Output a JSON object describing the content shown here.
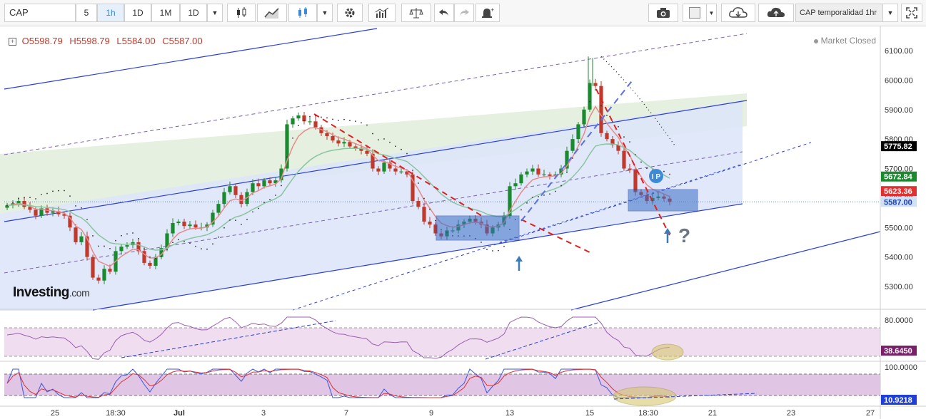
{
  "toolbar": {
    "symbol": "CAP",
    "intervals": [
      "5",
      "1h",
      "1D",
      "1M",
      "1D"
    ],
    "active_interval": "1h",
    "layout_name": "CAP temporalidad 1hr",
    "icons": [
      "dropdown-caret-icon",
      "candlestick-icon",
      "line-chart-icon",
      "candle-style-icon",
      "dropdown-caret-icon",
      "gear-icon",
      "indicators-icon",
      "compare-icon",
      "undo-icon",
      "redo-icon",
      "alert-icon",
      "camera-icon",
      "color-box-icon",
      "dropdown-caret-icon",
      "cloud-download-icon",
      "cloud-upload-icon",
      "dropdown-caret-icon",
      "fullscreen-icon"
    ]
  },
  "legend": {
    "open": "O5598.79",
    "high": "H5598.79",
    "low": "L5584.00",
    "close": "C5587.00"
  },
  "status": {
    "market": "Market Closed"
  },
  "logo": {
    "name": "Investing",
    "suffix": ".com"
  },
  "annotations": {
    "ip_label": "I P",
    "question_mark": "?"
  },
  "chart_data": [
    {
      "type": "candlestick",
      "title": "CAP",
      "ylabel": "",
      "ylim": [
        5220,
        6140
      ],
      "yticks": [
        5300,
        5400,
        5500,
        5600,
        5700,
        5800,
        5900,
        6000,
        6100
      ],
      "ytick_labels": [
        "5300.00",
        "5400.00",
        "5500.00",
        "5600.00",
        "5700.00",
        "5800.00",
        "5900.00",
        "6000.00",
        "6100.00"
      ],
      "xtick_labels": [
        "25",
        "18:30",
        "Jul",
        "3",
        "7",
        "9",
        "13",
        "15",
        "18:30",
        "21",
        "23",
        "27"
      ],
      "price_labels": [
        {
          "value": 5775.82,
          "label": "5775.82",
          "color": "#000000"
        },
        {
          "value": 5672.84,
          "label": "5672.84",
          "color": "#1a8a2e"
        },
        {
          "value": 5623.36,
          "label": "5623.36",
          "color": "#e03030"
        },
        {
          "value": 5587.0,
          "label": "5587.00",
          "color": "#cfe0f7"
        }
      ],
      "series": [
        {
          "name": "price",
          "type": "candle",
          "values": [
            5575,
            5582,
            5590,
            5570,
            5560,
            5540,
            5565,
            5550,
            5555,
            5545,
            5540,
            5500,
            5450,
            5470,
            5400,
            5330,
            5320,
            5360,
            5350,
            5420,
            5435,
            5440,
            5450,
            5420,
            5380,
            5370,
            5400,
            5430,
            5480,
            5515,
            5520,
            5505,
            5510,
            5500,
            5500,
            5510,
            5550,
            5580,
            5620,
            5640,
            5610,
            5580,
            5620,
            5650,
            5640,
            5660,
            5650,
            5660,
            5700,
            5850,
            5870,
            5880,
            5860,
            5860,
            5840,
            5820,
            5810,
            5795,
            5785,
            5790,
            5775,
            5770,
            5760,
            5750,
            5700,
            5690,
            5720,
            5700,
            5690,
            5690,
            5680,
            5590,
            5570,
            5520,
            5510,
            5480,
            5470,
            5490,
            5490,
            5510,
            5520,
            5530,
            5520,
            5510,
            5480,
            5500,
            5510,
            5540,
            5640,
            5650,
            5680,
            5690,
            5700,
            5680,
            5680,
            5675,
            5680,
            5700,
            5760,
            5800,
            5850,
            5900,
            5990,
            5980,
            5820,
            5800,
            5780,
            5760,
            5700,
            5695,
            5620,
            5610,
            5590,
            5600,
            5605,
            5598,
            5587
          ]
        },
        {
          "name": "ema-fast",
          "type": "line",
          "color": "#e88a8a"
        },
        {
          "name": "ema-slow",
          "type": "line",
          "color": "#8ac4a0"
        }
      ],
      "overlays": {
        "upper_channel_color": "#dcebd6",
        "lower_channel_color": "#dde6f8",
        "trend_color": "#2b3fd6",
        "projection_color": "#e02020",
        "support_boxes_color": "#3a6ec8"
      }
    },
    {
      "type": "line",
      "title": "",
      "ylim": [
        0,
        100
      ],
      "yticks": [
        80
      ],
      "ytick_labels": [
        "80.0000"
      ],
      "value_label": {
        "value": 38.645,
        "label": "38.6450",
        "color": "#7a1f6a"
      },
      "series": [
        {
          "name": "rsi",
          "color": "#9b5fb0"
        }
      ]
    },
    {
      "type": "line",
      "title": "",
      "ylim": [
        0,
        100
      ],
      "yticks": [
        100
      ],
      "ytick_labels": [
        "100.0000"
      ],
      "value_label": {
        "value": 10.9218,
        "label": "10.9218",
        "color": "#1f3fd6"
      },
      "series": [
        {
          "name": "stoch-k",
          "color": "#3a55e0"
        },
        {
          "name": "stoch-d",
          "color": "#e03030"
        }
      ]
    }
  ]
}
